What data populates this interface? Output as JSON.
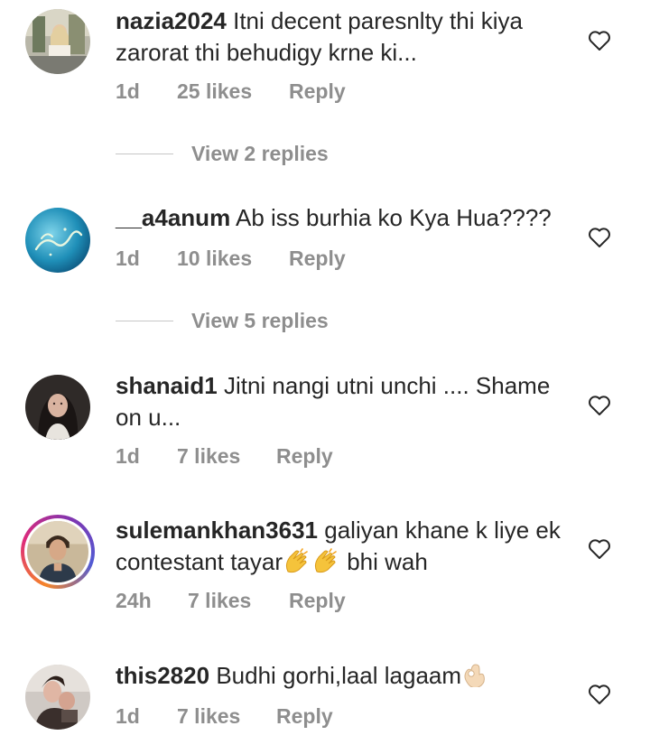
{
  "comments": [
    {
      "username": "nazia2024",
      "text": "Itni decent paresnlty thi kiya zarorat thi behudigy krne ki...",
      "time": "1d",
      "likes": "25 likes",
      "reply": "Reply",
      "view_replies": "View 2 replies"
    },
    {
      "username": "__a4anum",
      "text": "Ab iss burhia ko Kya Hua????",
      "time": "1d",
      "likes": "10 likes",
      "reply": "Reply",
      "view_replies": "View 5 replies"
    },
    {
      "username": "shanaid1",
      "text": "Jitni nangi utni unchi .... Shame on u...",
      "time": "1d",
      "likes": "7 likes",
      "reply": "Reply"
    },
    {
      "username": "sulemankhan3631",
      "text_before_emoji": "galiyan khane k liye ek contestant tayar",
      "text_after_emoji": " bhi wah",
      "emoji": "clapping-hands",
      "time": "24h",
      "likes": "7 likes",
      "reply": "Reply"
    },
    {
      "username": "this2820",
      "text": "Budhi gorhi,laal lagaam",
      "emoji": "ok-hand",
      "time": "1d",
      "likes": "7 likes",
      "reply": "Reply"
    }
  ],
  "colors": {
    "text": "#262626",
    "meta": "#8e8e8e",
    "divider": "#c7c7c7"
  }
}
